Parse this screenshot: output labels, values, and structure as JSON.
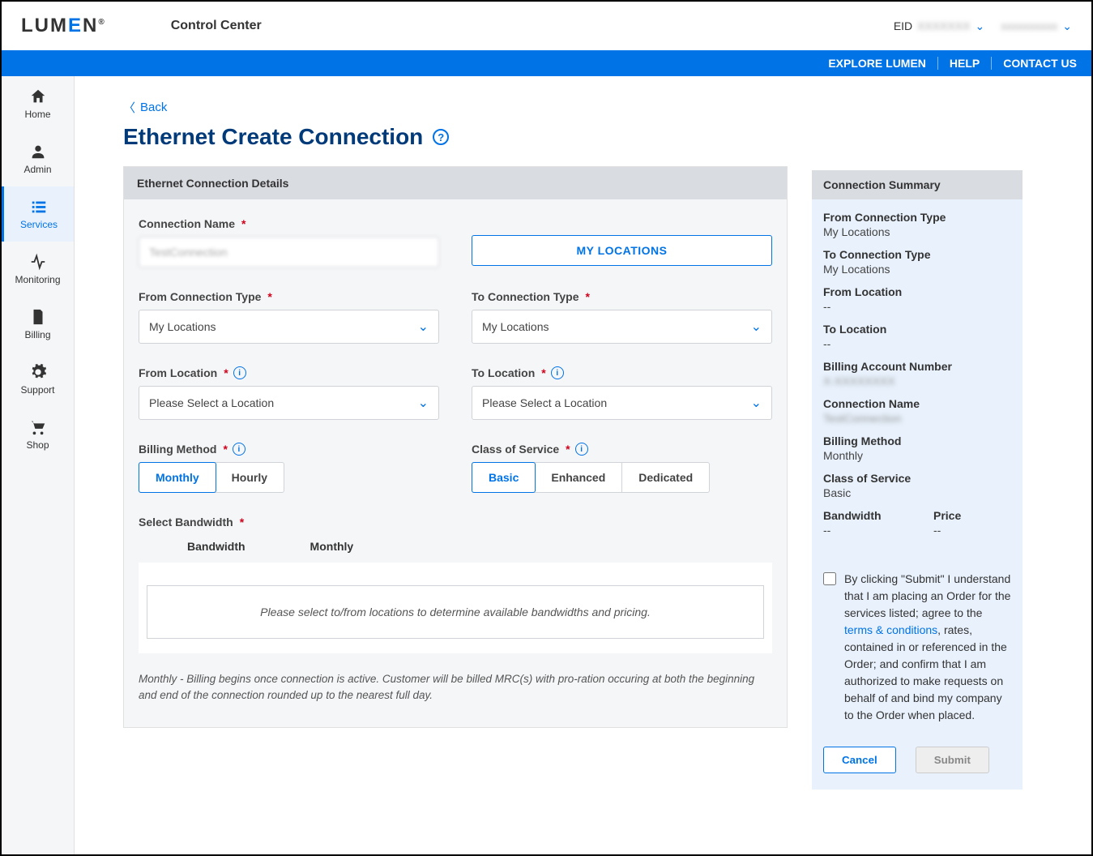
{
  "header": {
    "logo_text_pre": "LUM",
    "logo_text_e": "E",
    "logo_text_post": "N",
    "app_title": "Control Center",
    "eid_label": "EID",
    "eid_value": "XXXXXXX",
    "user_value": "xxxxxxxxxx"
  },
  "bluebar": {
    "explore": "EXPLORE LUMEN",
    "help": "HELP",
    "contact": "CONTACT US"
  },
  "sidebar": {
    "items": [
      {
        "label": "Home"
      },
      {
        "label": "Admin"
      },
      {
        "label": "Services"
      },
      {
        "label": "Monitoring"
      },
      {
        "label": "Billing"
      },
      {
        "label": "Support"
      },
      {
        "label": "Shop"
      }
    ]
  },
  "page": {
    "back_label": "Back",
    "title": "Ethernet Create Connection"
  },
  "details": {
    "header": "Ethernet Connection Details",
    "connection_name_label": "Connection Name",
    "connection_name_value": "TestConnection",
    "my_locations_btn": "MY LOCATIONS",
    "from_conn_type_label": "From Connection Type",
    "from_conn_type_value": "My Locations",
    "to_conn_type_label": "To Connection Type",
    "to_conn_type_value": "My Locations",
    "from_location_label": "From Location",
    "from_location_value": "Please Select a Location",
    "to_location_label": "To Location",
    "to_location_value": "Please Select a Location",
    "billing_method_label": "Billing Method",
    "billing_method_options": {
      "monthly": "Monthly",
      "hourly": "Hourly"
    },
    "cos_label": "Class of Service",
    "cos_options": {
      "basic": "Basic",
      "enhanced": "Enhanced",
      "dedicated": "Dedicated"
    },
    "bandwidth_label": "Select Bandwidth",
    "bandwidth_col1": "Bandwidth",
    "bandwidth_col2": "Monthly",
    "bandwidth_empty_text": "Please select to/from locations to determine available bandwidths and pricing.",
    "billing_note": "Monthly - Billing begins once connection is active. Customer will be billed MRC(s) with pro-ration occuring at both the beginning and end of the connection rounded up to the nearest full day."
  },
  "summary": {
    "header": "Connection Summary",
    "from_conn_type_label": "From Connection Type",
    "from_conn_type_value": "My Locations",
    "to_conn_type_label": "To Connection Type",
    "to_conn_type_value": "My Locations",
    "from_location_label": "From Location",
    "from_location_value": "--",
    "to_location_label": "To Location",
    "to_location_value": "--",
    "ban_label": "Billing Account Number",
    "ban_value": "X-XXXXXXXX",
    "conn_name_label": "Connection Name",
    "conn_name_value": "TestConnection",
    "billing_method_label": "Billing Method",
    "billing_method_value": "Monthly",
    "cos_label": "Class of Service",
    "cos_value": "Basic",
    "bandwidth_label": "Bandwidth",
    "bandwidth_value": "--",
    "price_label": "Price",
    "price_value": "--"
  },
  "consent": {
    "text_pre": "By clicking \"Submit\" I understand that I am placing an Order for the services listed; agree to the ",
    "tc_link": "terms & conditions",
    "text_post": ", rates, contained in or referenced in the Order; and confirm that I am authorized to make requests on behalf of and bind my company to the Order when placed."
  },
  "actions": {
    "cancel": "Cancel",
    "submit": "Submit"
  }
}
